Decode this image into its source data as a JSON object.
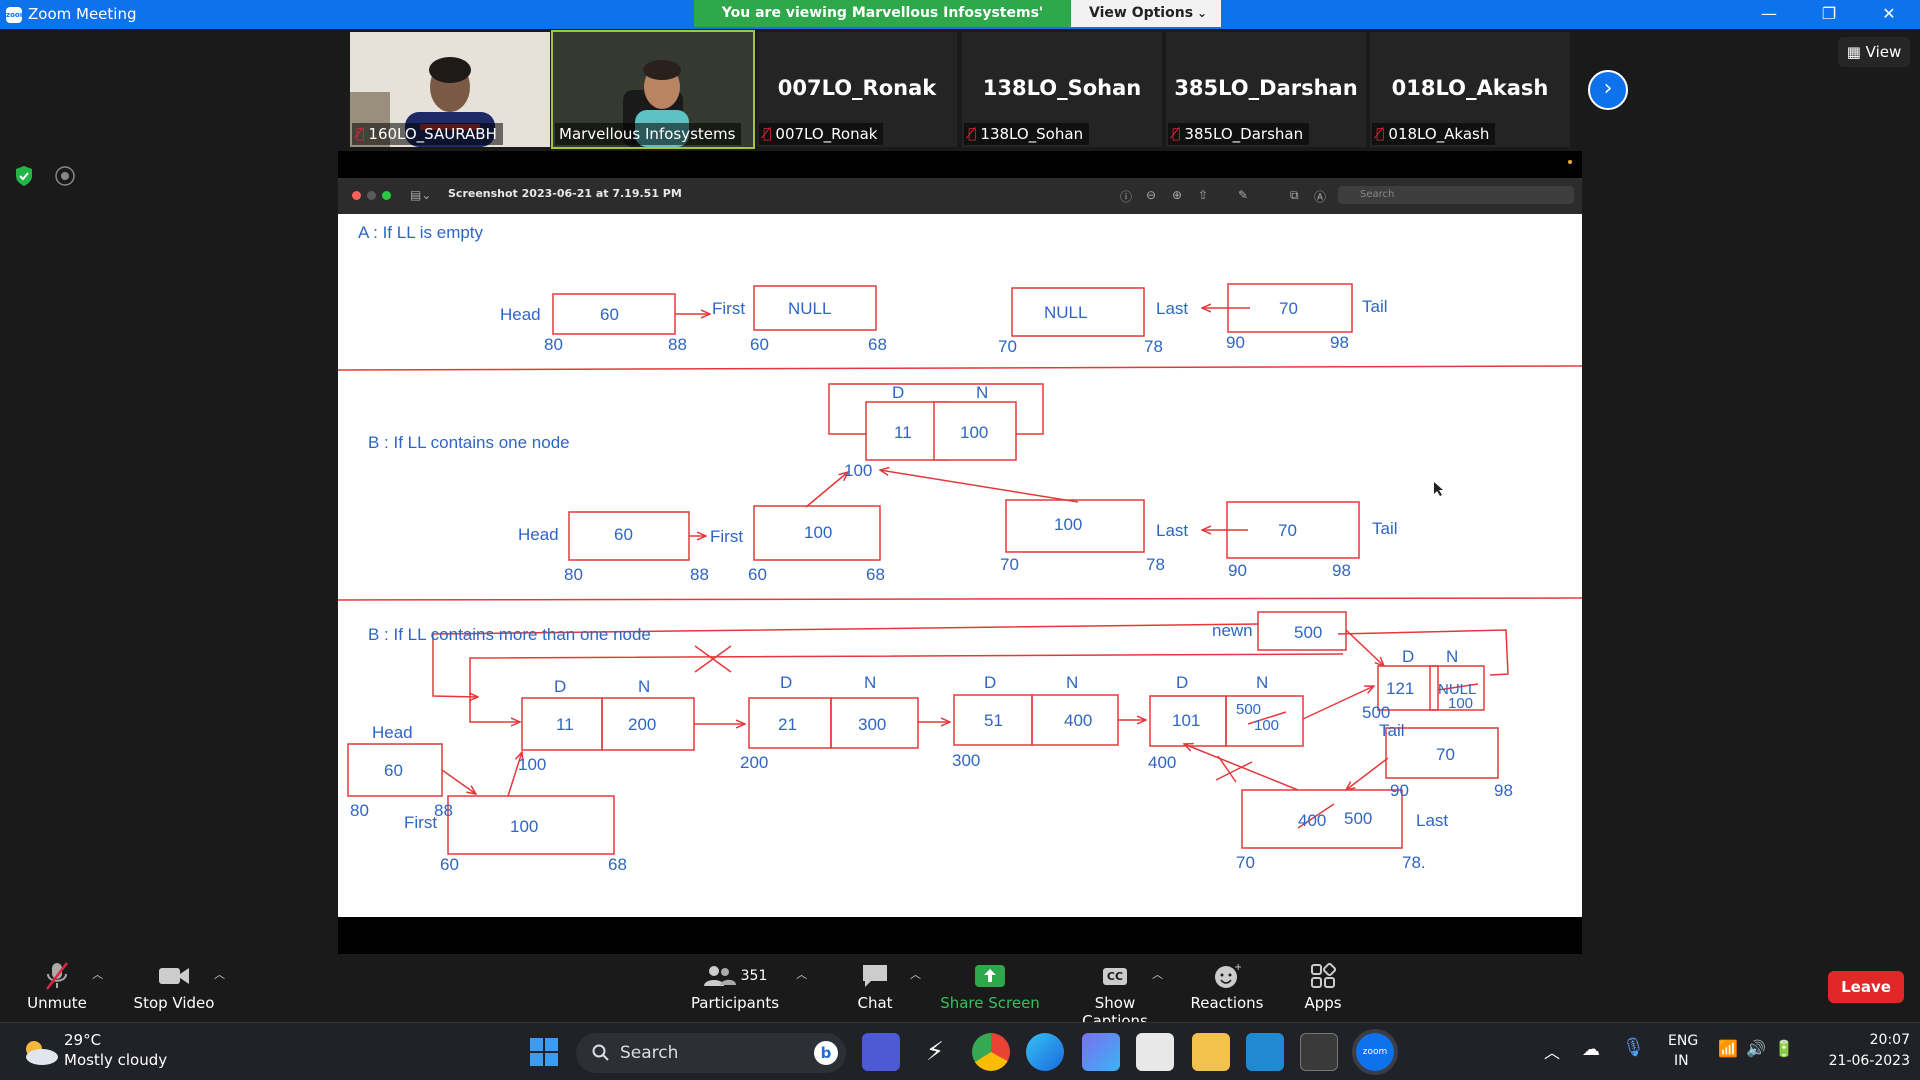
{
  "window": {
    "title": "Zoom Meeting",
    "app_icon": "zoom"
  },
  "share_banner": "You are viewing Marvellous Infosystems' screen",
  "view_options": "View Options",
  "view_button": "View",
  "participants_strip": [
    {
      "name": "160LO_SAURABH",
      "muted": true,
      "video": true
    },
    {
      "name": "Marvellous Infosystems",
      "muted": false,
      "video": true,
      "active_speaker": true
    },
    {
      "name": "007LO_Ronak",
      "muted": true,
      "video": false
    },
    {
      "name": "138LO_Sohan",
      "muted": true,
      "video": false
    },
    {
      "name": "385LO_Darshan",
      "muted": true,
      "video": false
    },
    {
      "name": "018LO_Akash",
      "muted": true,
      "video": false
    }
  ],
  "shared_doc": {
    "title": "Screenshot 2023-06-21 at 7.19.51 PM",
    "search_placeholder": "Search",
    "section_a": {
      "heading": "A : If LL is empty",
      "head_label": "Head",
      "head_value": "60",
      "head_start": "80",
      "head_end": "88",
      "first_label": "First",
      "first_value": "NULL",
      "first_start": "60",
      "first_end": "68",
      "last_label": "Last",
      "last_value": "NULL",
      "last_start": "70",
      "last_end": "78",
      "tail_label": "Tail",
      "tail_value": "70",
      "tail_start": "90",
      "tail_end": "98"
    },
    "section_b": {
      "heading": "B : If LL contains one node",
      "node_d": "D",
      "node_n": "N",
      "node_data": "11",
      "node_next": "100",
      "node_addr": "100",
      "head_label": "Head",
      "head_value": "60",
      "head_start": "80",
      "head_end": "88",
      "first_label": "First",
      "first_value": "100",
      "first_start": "60",
      "first_end": "68",
      "last_label": "Last",
      "last_value": "100",
      "last_start": "70",
      "last_end": "78",
      "tail_label": "Tail",
      "tail_value": "70",
      "tail_start": "90",
      "tail_end": "98"
    },
    "section_c": {
      "heading": "B : If LL contains more than one node",
      "newn_label": "newn",
      "newn_value": "500",
      "nodes": [
        {
          "d": "11",
          "n": "200",
          "addr": "100"
        },
        {
          "d": "21",
          "n": "300",
          "addr": "200"
        },
        {
          "d": "51",
          "n": "400",
          "addr": "300"
        },
        {
          "d": "101",
          "n_old": "100",
          "n_new": "500",
          "addr": "400"
        }
      ],
      "new_node": {
        "d": "121",
        "n_old": "NULL",
        "n_new": "100",
        "addr": "500"
      },
      "col_d": "D",
      "col_n": "N",
      "head_label": "Head",
      "head_value": "60",
      "head_start": "80",
      "head_end": "88",
      "first_label": "First",
      "first_value": "100",
      "first_start": "60",
      "first_end": "68",
      "tail_label": "Tail",
      "tail_value": "70",
      "tail_start": "90",
      "tail_end": "98",
      "last_label": "Last",
      "last_old": "400",
      "last_new": "500",
      "last_start": "70",
      "last_end": "78."
    }
  },
  "toolbar": {
    "unmute": "Unmute",
    "stop_video": "Stop Video",
    "participants": "Participants",
    "participants_count": "351",
    "chat": "Chat",
    "share_screen": "Share Screen",
    "show_captions": "Show Captions",
    "captions_badge": "CC",
    "reactions": "Reactions",
    "apps": "Apps",
    "leave": "Leave"
  },
  "taskbar": {
    "weather_temp": "29°C",
    "weather_desc": "Mostly cloudy",
    "search": "Search",
    "lang": "ENG",
    "region": "IN",
    "time": "20:07",
    "date": "21-06-2023"
  },
  "colors": {
    "zoom_blue": "#0e72ed",
    "share_green": "#2ea84a",
    "diagram_red": "#e5383b",
    "diagram_blue": "#2f66c4",
    "leave_red": "#e02828"
  }
}
